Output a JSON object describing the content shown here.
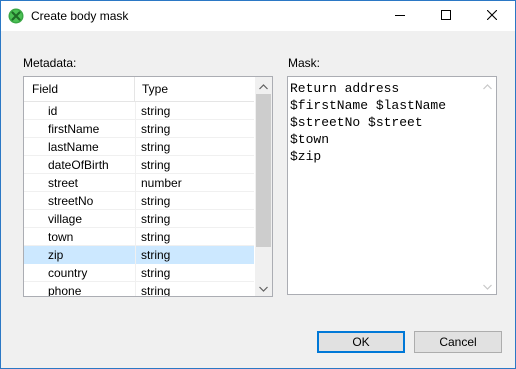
{
  "window": {
    "title": "Create body mask",
    "icon": "green-cross-circle-icon",
    "controls": [
      "minimize-icon",
      "maximize-icon",
      "close-icon"
    ]
  },
  "metadata": {
    "label": "Metadata:",
    "columns": [
      "Field",
      "Type"
    ],
    "rows": [
      {
        "field": "id",
        "type": "string"
      },
      {
        "field": "firstName",
        "type": "string"
      },
      {
        "field": "lastName",
        "type": "string"
      },
      {
        "field": "dateOfBirth",
        "type": "string"
      },
      {
        "field": "street",
        "type": "number"
      },
      {
        "field": "streetNo",
        "type": "string"
      },
      {
        "field": "village",
        "type": "string"
      },
      {
        "field": "town",
        "type": "string"
      },
      {
        "field": "zip",
        "type": "string"
      },
      {
        "field": "country",
        "type": "string"
      },
      {
        "field": "phone",
        "type": "string"
      }
    ],
    "selected_field": "zip"
  },
  "mask": {
    "label": "Mask:",
    "text": "Return address\n$firstName $lastName\n$streetNo $street\n$town\n$zip"
  },
  "buttons": {
    "ok": "OK",
    "cancel": "Cancel"
  },
  "colors": {
    "selection": "#cce8ff",
    "default_button_border": "#0078d7",
    "window_border": "#2b78c5"
  }
}
